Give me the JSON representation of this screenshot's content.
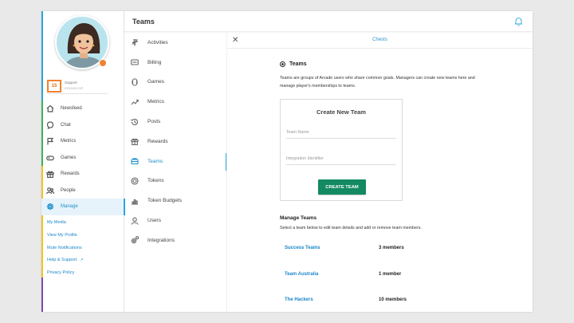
{
  "profile": {
    "level": "15",
    "support_label": "Support",
    "support_value": "675/1000 XP"
  },
  "sidebar": {
    "items": [
      {
        "label": "Newsfeed",
        "icon": "house-icon",
        "accent": "#3cb35a"
      },
      {
        "label": "Chat",
        "icon": "chat-bubble-icon",
        "accent": "#3cb35a"
      },
      {
        "label": "Metrics",
        "icon": "flag-icon",
        "accent": "#3cb35a"
      },
      {
        "label": "Games",
        "icon": "gamepad-icon",
        "accent": "#3cb35a"
      },
      {
        "label": "Rewards",
        "icon": "gift-icon",
        "accent": "#f0c420"
      },
      {
        "label": "People",
        "icon": "people-icon",
        "accent": "#f0c420"
      },
      {
        "label": "Manage",
        "icon": "gear-icon",
        "accent": "#f0c420",
        "active": true
      }
    ],
    "links": [
      {
        "label": "My Media"
      },
      {
        "label": "View My Profile"
      },
      {
        "label": "Mute Notifications"
      },
      {
        "label": "Help & Support",
        "ext": "↗"
      },
      {
        "label": "Privacy Policy"
      }
    ]
  },
  "header": {
    "title": "Teams"
  },
  "settings_nav": {
    "items": [
      {
        "label": "Activities",
        "icon": "activities-icon"
      },
      {
        "label": "Billing",
        "icon": "billing-icon"
      },
      {
        "label": "Games",
        "icon": "games-icon"
      },
      {
        "label": "Metrics",
        "icon": "metrics-trend-icon"
      },
      {
        "label": "Posts",
        "icon": "posts-history-icon"
      },
      {
        "label": "Rewards",
        "icon": "rewards-gift-icon"
      },
      {
        "label": "Teams",
        "icon": "teams-icon",
        "active": true
      },
      {
        "label": "Tokens",
        "icon": "token-icon"
      },
      {
        "label": "Token Budgets",
        "icon": "token-budgets-icon"
      },
      {
        "label": "Users",
        "icon": "user-icon"
      },
      {
        "label": "Integrations",
        "icon": "integrations-icon"
      }
    ]
  },
  "panel": {
    "close_label": "✕",
    "title": "Chests",
    "teams_heading": "Teams",
    "description": "Teams are groups of Arcade users who share common goals. Managers can create new teams here and manage player's memberships to teams.",
    "create_card": {
      "title": "Create New Team",
      "team_name_placeholder": "Team Name",
      "integration_placeholder": "Integration Identifier",
      "button": "CREATE TEAM"
    },
    "manage_heading": "Manage Teams",
    "manage_sub": "Select a team below to edit team details and add or remove team members.",
    "teams": [
      {
        "name": "Success Teams",
        "count": "3 members"
      },
      {
        "name": "Team Australia",
        "count": "1 member"
      },
      {
        "name": "The Hackers",
        "count": "10 members"
      }
    ]
  },
  "colors": {
    "link_blue": "#1b87c9",
    "create_green": "#138a62",
    "level_orange": "#f0822f",
    "purple_accent": "#7b4bb0"
  }
}
